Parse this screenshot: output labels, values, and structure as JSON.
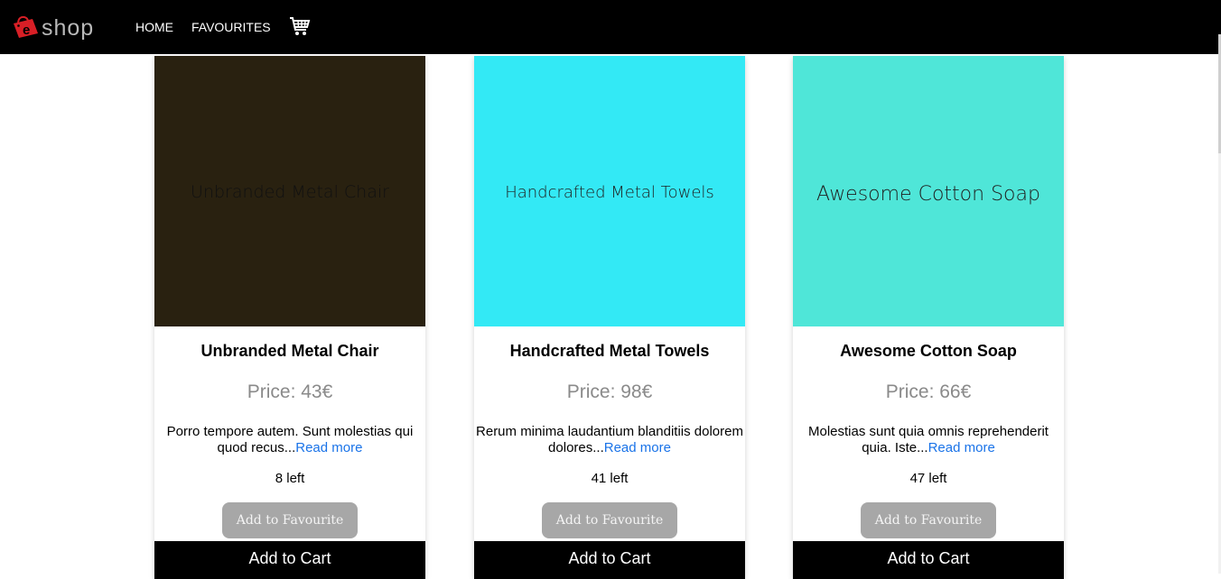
{
  "navbar": {
    "logo_text": "shop",
    "links": [
      {
        "label": "HOME"
      },
      {
        "label": "FAVOURITES"
      }
    ],
    "cart_icon": "shopping-cart-icon"
  },
  "colors": {
    "navbar_bg": "#000000",
    "logo_red": "#d81f26",
    "link": "#1a73e8",
    "button_gray": "#a7a7a7",
    "price_gray": "#8a8a8a"
  },
  "products": [
    {
      "image_text": "Unbranded Metal Chair",
      "image_color": "#292110",
      "title": "Unbranded Metal Chair",
      "price": "Price: 43€",
      "description": "Porro tempore autem. Sunt molestias qui quod recus...",
      "read_more": "Read more",
      "stock": "8 left",
      "fav_label": "Add to Favourite",
      "cart_label": "Add to Cart"
    },
    {
      "image_text": "Handcrafted Metal Towels",
      "image_color": "#33e9f5",
      "title": "Handcrafted Metal Towels",
      "price": "Price: 98€",
      "description": "Rerum minima laudantium blanditiis dolorem dolores...",
      "read_more": "Read more",
      "stock": "41 left",
      "fav_label": "Add to Favourite",
      "cart_label": "Add to Cart"
    },
    {
      "image_text": "Awesome Cotton Soap",
      "image_color": "#4fe6d8",
      "title": "Awesome Cotton Soap",
      "price": "Price: 66€",
      "description": "Molestias sunt quia omnis reprehenderit quia. Iste...",
      "read_more": "Read more",
      "stock": "47 left",
      "fav_label": "Add to Favourite",
      "cart_label": "Add to Cart"
    }
  ]
}
